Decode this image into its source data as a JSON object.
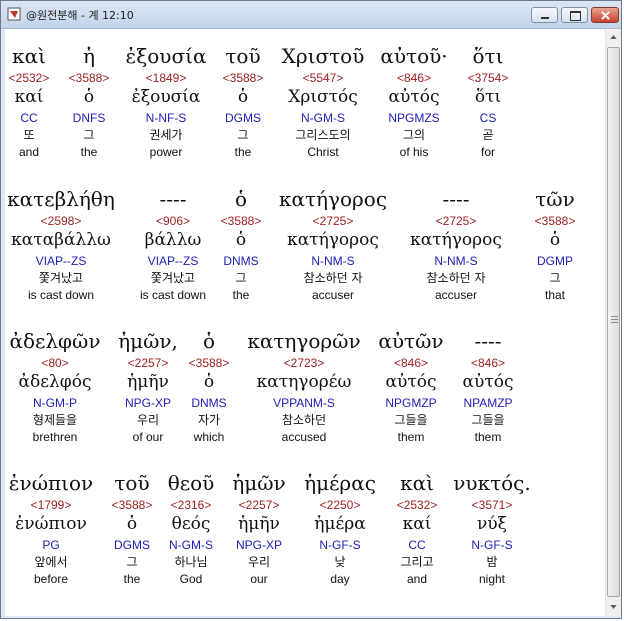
{
  "window": {
    "title": "@원전분해 - 계 12:10",
    "accent": "#2020b4",
    "strong_color": "#9c1e1e"
  },
  "rows": [
    {
      "words": [
        {
          "greek": "καὶ",
          "strong": "<2532>",
          "lemma": "καί",
          "parse": "CC",
          "korean": "또",
          "english": "and"
        },
        {
          "greek": "ἡ",
          "strong": "<3588>",
          "lemma": "ὁ",
          "parse": "DNFS",
          "korean": "그",
          "english": "the"
        },
        {
          "greek": "ἐξουσία",
          "strong": "<1849>",
          "lemma": "ἐξουσία",
          "parse": "N-NF-S",
          "korean": "권세가",
          "english": "power"
        },
        {
          "greek": "τοῦ",
          "strong": "<3588>",
          "lemma": "ὁ",
          "parse": "DGMS",
          "korean": "그",
          "english": "the"
        },
        {
          "greek": "Χριστοῦ",
          "strong": "<5547>",
          "lemma": "Χριστός",
          "parse": "N-GM-S",
          "korean": "그리스도의",
          "english": "Christ"
        },
        {
          "greek": "αὐτοῦ·",
          "strong": "<846>",
          "lemma": "αὐτός",
          "parse": "NPGMZS",
          "korean": "그의",
          "english": "of his"
        },
        {
          "greek": "ὅτι",
          "strong": "<3754>",
          "lemma": "ὅτι",
          "parse": "CS",
          "korean": "곧",
          "english": "for"
        }
      ]
    },
    {
      "words": [
        {
          "greek": "κατεβλήθη",
          "strong": "<2598>",
          "lemma": "καταβάλλω",
          "parse": "VIAP--ZS",
          "korean": "쫓겨났고",
          "english": "is cast down"
        },
        {
          "greek": "----",
          "strong": "<906>",
          "lemma": "βάλλω",
          "parse": "VIAP--ZS",
          "korean": "쫓겨났고",
          "english": "is cast down"
        },
        {
          "greek": "ὁ",
          "strong": "<3588>",
          "lemma": "ὁ",
          "parse": "DNMS",
          "korean": "그",
          "english": "the"
        },
        {
          "greek": "κατήγορος",
          "strong": "<2725>",
          "lemma": "κατήγορος",
          "parse": "N-NM-S",
          "korean": "참소하던 자",
          "english": "accuser"
        },
        {
          "greek": "----",
          "strong": "<2725>",
          "lemma": "κατήγορος",
          "parse": "N-NM-S",
          "korean": "참소하던 자",
          "english": "accuser"
        },
        {
          "greek": "τῶν",
          "strong": "<3588>",
          "lemma": "ὁ",
          "parse": "DGMP",
          "korean": "그",
          "english": "that"
        }
      ]
    },
    {
      "words": [
        {
          "greek": "ἀδελφῶν",
          "strong": "<80>",
          "lemma": "ἀδελφός",
          "parse": "N-GM-P",
          "korean": "형제들을",
          "english": "brethren"
        },
        {
          "greek": "ἡμῶν,",
          "strong": "<2257>",
          "lemma": "ἡμῆν",
          "parse": "NPG-XP",
          "korean": "우리",
          "english": "of our"
        },
        {
          "greek": "ὁ",
          "strong": "<3588>",
          "lemma": "ὁ",
          "parse": "DNMS",
          "korean": "자가",
          "english": "which"
        },
        {
          "greek": "κατηγορῶν",
          "strong": "<2723>",
          "lemma": "κατηγορέω",
          "parse": "VPPANM-S",
          "korean": "참소하던",
          "english": "accused"
        },
        {
          "greek": "αὐτῶν",
          "strong": "<846>",
          "lemma": "αὐτός",
          "parse": "NPGMZP",
          "korean": "그들을",
          "english": "them"
        },
        {
          "greek": "----",
          "strong": "<846>",
          "lemma": "αὐτός",
          "parse": "NPAMZP",
          "korean": "그들을",
          "english": "them"
        }
      ]
    },
    {
      "words": [
        {
          "greek": "ἐνώπιον",
          "strong": "<1799>",
          "lemma": "ἐνώπιον",
          "parse": "PG",
          "korean": "앞에서",
          "english": "before"
        },
        {
          "greek": "τοῦ",
          "strong": "<3588>",
          "lemma": "ὁ",
          "parse": "DGMS",
          "korean": "그",
          "english": "the"
        },
        {
          "greek": "θεοῦ",
          "strong": "<2316>",
          "lemma": "θεός",
          "parse": "N-GM-S",
          "korean": "하나님",
          "english": "God"
        },
        {
          "greek": "ἡμῶν",
          "strong": "<2257>",
          "lemma": "ἡμῆν",
          "parse": "NPG-XP",
          "korean": "우리",
          "english": "our"
        },
        {
          "greek": "ἡμέρας",
          "strong": "<2250>",
          "lemma": "ἡμέρα",
          "parse": "N-GF-S",
          "korean": "낮",
          "english": "day"
        },
        {
          "greek": "καὶ",
          "strong": "<2532>",
          "lemma": "καί",
          "parse": "CC",
          "korean": "그리고",
          "english": "and"
        },
        {
          "greek": "νυκτός.",
          "strong": "<3571>",
          "lemma": "νύξ",
          "parse": "N-GF-S",
          "korean": "밤",
          "english": "night"
        }
      ]
    }
  ]
}
